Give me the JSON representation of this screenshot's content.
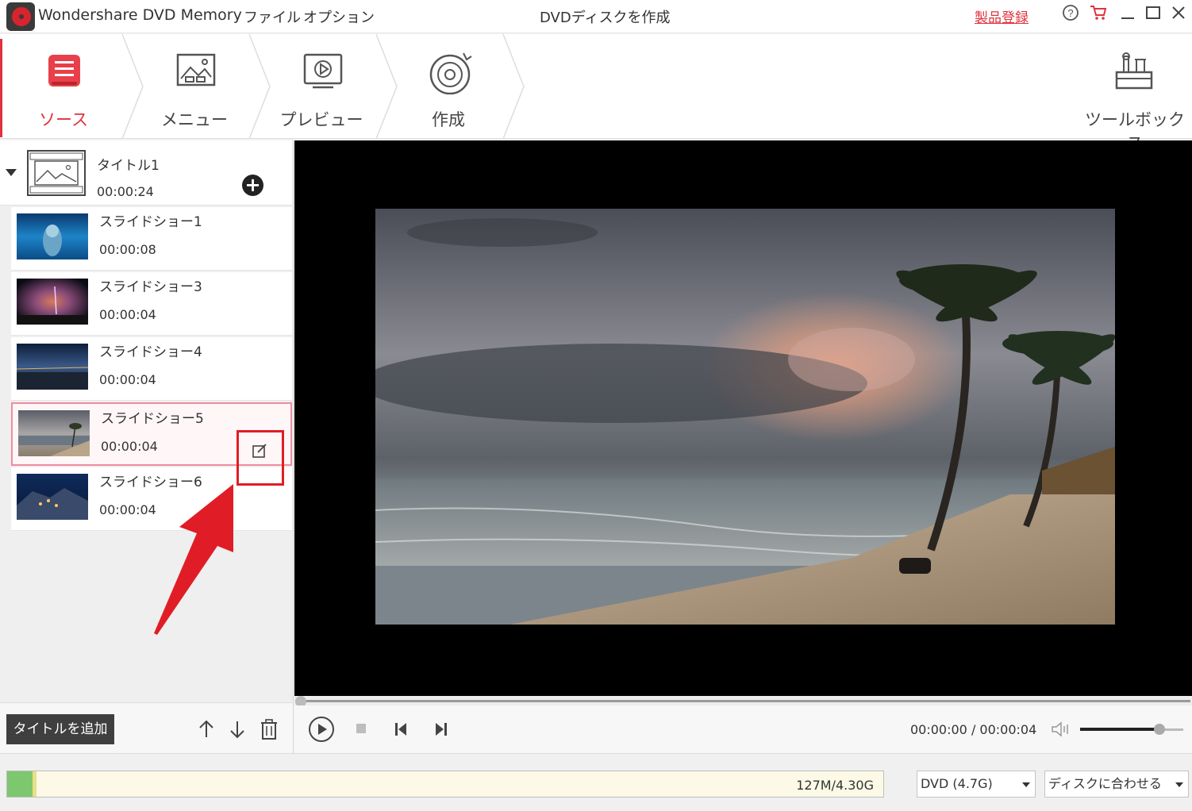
{
  "app": {
    "name": "Wondershare DVD Memory",
    "window_title": "DVDディスクを作成",
    "register_label": "製品登録"
  },
  "menus": [
    {
      "label": "ファイル"
    },
    {
      "label": "オプション"
    }
  ],
  "window_icons": [
    "help-icon",
    "cart-icon",
    "minimize-icon",
    "maximize-icon",
    "close-icon"
  ],
  "steps": [
    {
      "label": "ソース",
      "icon": "source-icon",
      "active": true
    },
    {
      "label": "メニュー",
      "icon": "menu-template-icon",
      "active": false
    },
    {
      "label": "プレビュー",
      "icon": "preview-icon",
      "active": false
    },
    {
      "label": "作成",
      "icon": "burn-disc-icon",
      "active": false
    }
  ],
  "toolbox": {
    "label": "ツールボックス",
    "icon": "toolbox-icon"
  },
  "title_item": {
    "name": "タイトル1",
    "duration": "00:00:24"
  },
  "slides": [
    {
      "name": "スライドショー1",
      "duration": "00:00:08"
    },
    {
      "name": "スライドショー3",
      "duration": "00:00:04"
    },
    {
      "name": "スライドショー4",
      "duration": "00:00:04"
    },
    {
      "name": "スライドショー5",
      "duration": "00:00:04",
      "selected": true
    },
    {
      "name": "スライドショー6",
      "duration": "00:00:04"
    }
  ],
  "left_bottom": {
    "add_title_label": "タイトルを追加"
  },
  "player": {
    "time": "00:00:00 / 00:00:04",
    "volume": 0.77,
    "progress": 0
  },
  "status": {
    "capacity_text": "127M/4.30G",
    "capacity_fraction": 0.029,
    "disc_type": "DVD (4.7G)",
    "fit_mode": "ディスクに合わせる"
  },
  "colors": {
    "accent": "#e0323c",
    "annotation_red": "#e01d26",
    "preview_bg": "#000000",
    "capacity_green": "#7dc86e"
  }
}
